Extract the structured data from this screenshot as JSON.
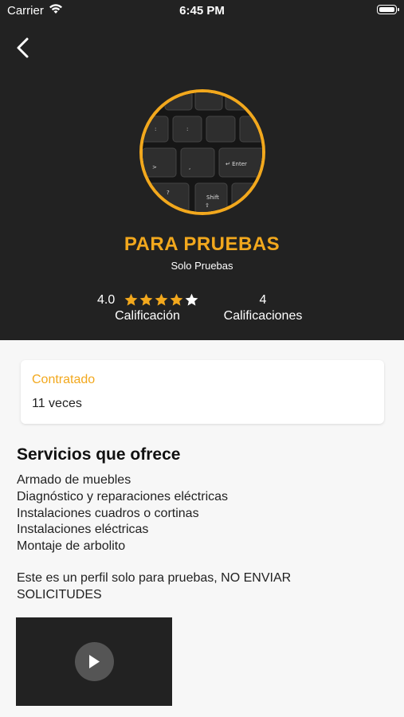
{
  "status_bar": {
    "carrier": "Carrier",
    "time": "6:45 PM"
  },
  "header": {
    "background": "#222222",
    "accent": "#f2a81d"
  },
  "profile": {
    "name": "PARA PRUEBAS",
    "subtitle": "Solo Pruebas",
    "avatar_icon": "keyboard-photo",
    "rating_value": "4.0",
    "rating_stars": 4,
    "rating_max": 5,
    "rating_label": "Calificación",
    "ratings_count": "4",
    "ratings_count_label": "Calificaciones"
  },
  "hired": {
    "label": "Contratado",
    "value": "11 veces"
  },
  "services": {
    "title": "Servicios que ofrece",
    "items": [
      "Armado de muebles",
      "Diagnóstico y reparaciones eléctricas",
      "Instalaciones cuadros o cortinas",
      "Instalaciones eléctricas",
      "Montaje de arbolito"
    ]
  },
  "description": "Este es un perfil solo para pruebas, NO ENVIAR SOLICITUDES",
  "video": {
    "icon": "play-icon"
  }
}
